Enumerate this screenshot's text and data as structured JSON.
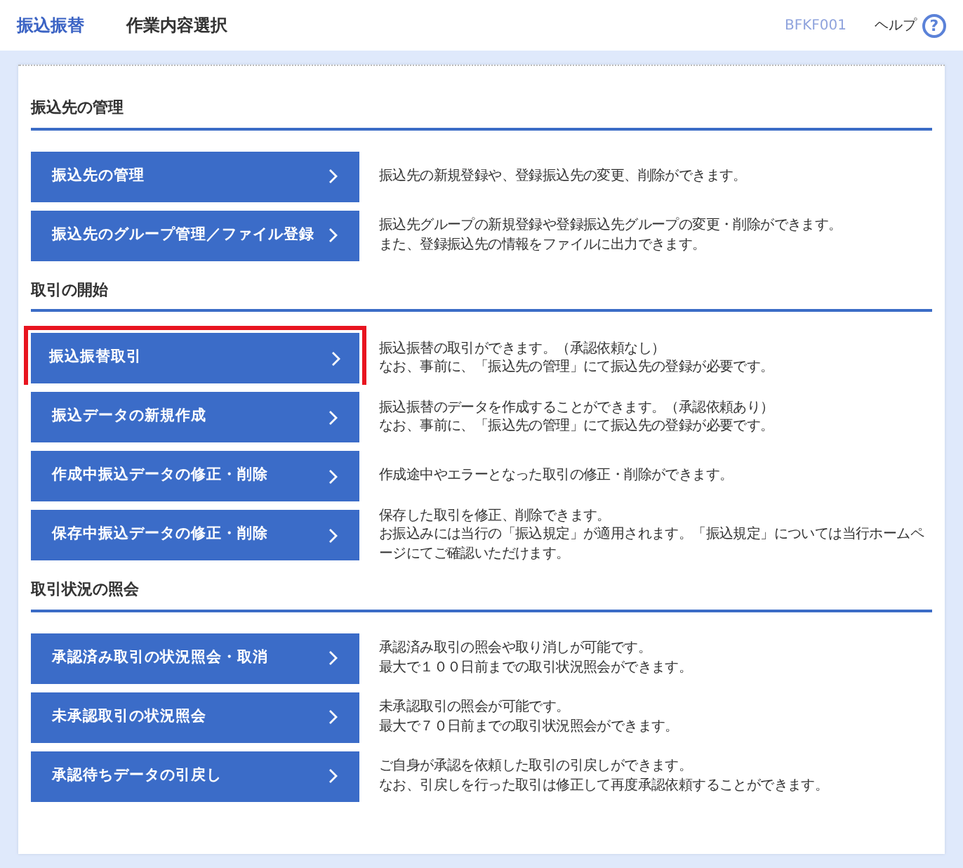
{
  "header": {
    "title": "振込振替",
    "subtitle": "作業内容選択",
    "screen_id": "BFKF001",
    "help": "ヘルプ",
    "help_icon": "?"
  },
  "sections": [
    {
      "title": "振込先の管理",
      "items": [
        {
          "label": "振込先の管理",
          "highlighted": false,
          "description": [
            "振込先の新規登録や、登録振込先の変更、削除ができます。"
          ]
        },
        {
          "label": "振込先のグループ管理／ファイル登録",
          "highlighted": false,
          "description": [
            "振込先グループの新規登録や登録振込先グループの変更・削除ができます。",
            "また、登録振込先の情報をファイルに出力できます。"
          ]
        }
      ]
    },
    {
      "title": "取引の開始",
      "items": [
        {
          "label": "振込振替取引",
          "highlighted": true,
          "description": [
            "振込振替の取引ができます。（承認依頼なし）",
            "なお、事前に、「振込先の管理」にて振込先の登録が必要です。"
          ]
        },
        {
          "label": "振込データの新規作成",
          "highlighted": false,
          "description": [
            "振込振替のデータを作成することができます。（承認依頼あり）",
            "なお、事前に、「振込先の管理」にて振込先の登録が必要です。"
          ]
        },
        {
          "label": "作成中振込データの修正・削除",
          "highlighted": false,
          "description": [
            "作成途中やエラーとなった取引の修正・削除ができます。"
          ]
        },
        {
          "label": "保存中振込データの修正・削除",
          "highlighted": false,
          "description": [
            "保存した取引を修正、削除できます。",
            "お振込みには当行の「振込規定」が適用されます。「振込規定」については当行ホームページにてご確認いただけます。"
          ]
        }
      ]
    },
    {
      "title": "取引状況の照会",
      "items": [
        {
          "label": "承認済み取引の状況照会・取消",
          "highlighted": false,
          "description": [
            "承認済み取引の照会や取り消しが可能です。",
            "最大で１００日前までの取引状況照会ができます。"
          ]
        },
        {
          "label": "未承認取引の状況照会",
          "highlighted": false,
          "description": [
            "未承認取引の照会が可能です。",
            "最大で７０日前までの取引状況照会ができます。"
          ]
        },
        {
          "label": "承認待ちデータの引戻し",
          "highlighted": false,
          "description": [
            "ご自身が承認を依頼した取引の引戻しができます。",
            "なお、引戻しを行った取引は修正して再度承認依頼することができます。"
          ]
        }
      ]
    }
  ]
}
